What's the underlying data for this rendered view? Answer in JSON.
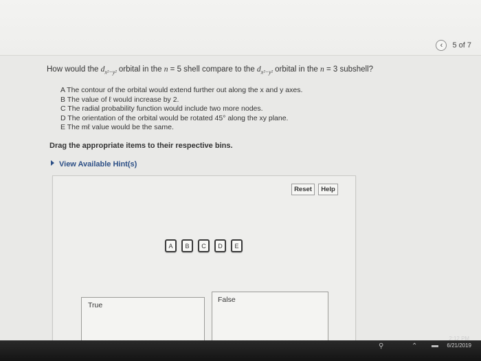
{
  "pager": {
    "prev_icon": "chevron-left-icon",
    "prev_glyph": "‹",
    "label": "5 of 7"
  },
  "question": {
    "p1": "How would the ",
    "sym": "d",
    "sub": "x²−y²",
    "p2": " orbital in the ",
    "n_sym": "n",
    "p3": " = 5 shell compare to the ",
    "sym2": "d",
    "sub2": "x²−y²",
    "p4": " orbital in the ",
    "n_sym2": "n",
    "p5": " = 3 subshell?"
  },
  "options": [
    "A  The contour of the orbital would extend further out along the x and y axes.",
    "B  The value of ℓ would increase by 2.",
    "C  The radial probability function would include two more nodes.",
    "D  The orientation of the orbital would be rotated 45° along the xy plane.",
    "E  The mℓ value would be the same."
  ],
  "instruction": "Drag the appropriate items to their respective bins.",
  "hint": {
    "label": "View Available Hint(s)",
    "icon": "triangle-right-icon"
  },
  "buttons": {
    "reset": "Reset",
    "help": "Help"
  },
  "tiles": [
    "A",
    "B",
    "C",
    "D",
    "E"
  ],
  "bins": {
    "true_label": "True",
    "false_label": "False"
  },
  "taskbar": {
    "time": "2:12 PM",
    "date": "6/21/2019"
  }
}
